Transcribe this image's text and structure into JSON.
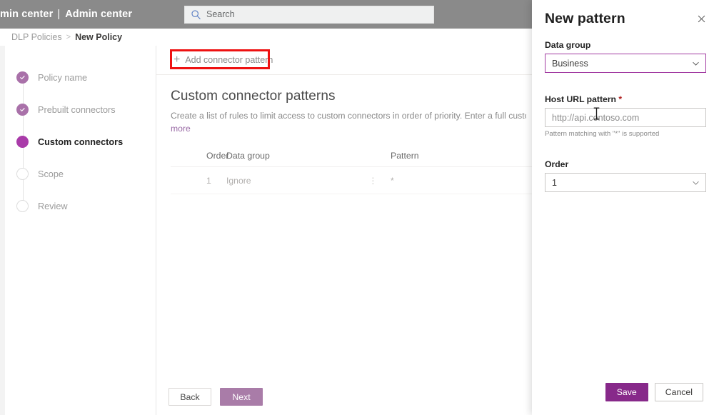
{
  "suitebar": {
    "title_clipped": "min center",
    "separator": "|",
    "title_second": "Admin center",
    "search_placeholder": "Search",
    "search_icon": "search-icon",
    "background": "#8a8a8a"
  },
  "breadcrumb": {
    "parent": "DLP Policies",
    "separator": ">",
    "current": "New Policy"
  },
  "stepper": {
    "steps": [
      {
        "label": "Policy name",
        "state": "done"
      },
      {
        "label": "Prebuilt connectors",
        "state": "done"
      },
      {
        "label": "Custom connectors",
        "state": "current"
      },
      {
        "label": "Scope",
        "state": "todo"
      },
      {
        "label": "Review",
        "state": "todo"
      }
    ],
    "done_color": "#a971a9",
    "current_color": "#a93ba9"
  },
  "command_bar": {
    "add_pattern_label": "Add connector pattern",
    "add_pattern_icon": "plus-icon",
    "highlight_color": "#ee1111"
  },
  "section": {
    "title": "Custom connector patterns",
    "description": "Create a list of rules to limit access to custom connectors in order of priority. Enter a full custom connector U",
    "description_link": "more"
  },
  "table": {
    "columns": [
      "Order",
      "Data group",
      "Pattern"
    ],
    "menu_icon": "more-vertical-icon",
    "rows": [
      {
        "order": "1",
        "data_group": "Ignore",
        "pattern": "*"
      }
    ]
  },
  "wizard": {
    "back_label": "Back",
    "next_label": "Next",
    "next_color": "#a97ca8"
  },
  "flyout": {
    "title": "New pattern",
    "close_icon": "close-icon",
    "data_group": {
      "label": "Data group",
      "value": "Business",
      "chevron_icon": "chevron-down-icon",
      "focus_color": "#a23ba2"
    },
    "host_url": {
      "label": "Host URL pattern",
      "required_marker": "*",
      "placeholder": "http://api.contoso.com",
      "hint": "Pattern matching with \"*\" is supported"
    },
    "order": {
      "label": "Order",
      "value": "1",
      "chevron_icon": "chevron-down-icon"
    },
    "save_label": "Save",
    "cancel_label": "Cancel",
    "save_color": "#87298a"
  }
}
